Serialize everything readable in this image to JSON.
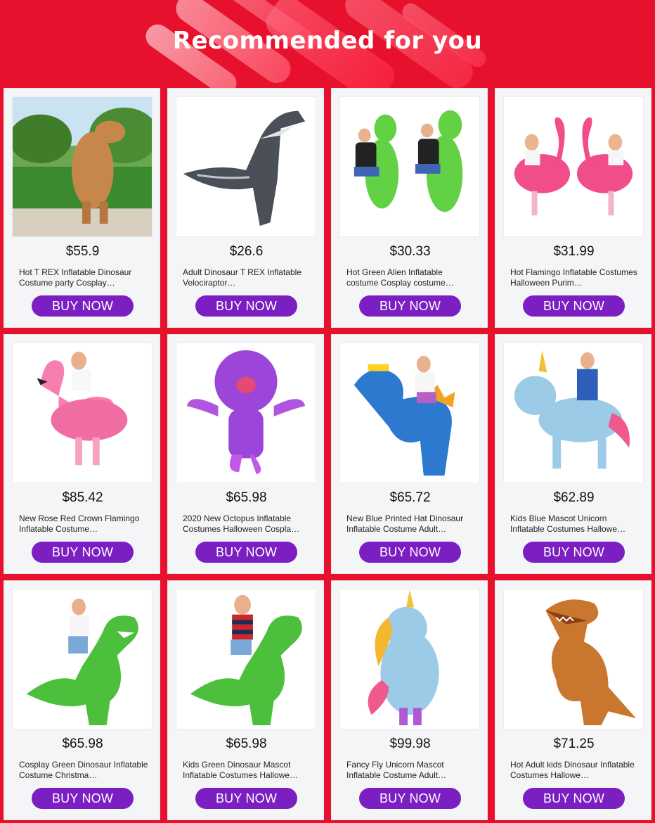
{
  "header": {
    "title": "Recommended for you"
  },
  "theme": {
    "background": "#e8112d",
    "button": "#7b1fc2",
    "card": "#f4f5f7"
  },
  "products": [
    {
      "price": "$55.9",
      "name": "Hot T REX Inflatable Dinosaur Costume party Cosplay…",
      "button": "BUY NOW",
      "image": "trex-costume-garden"
    },
    {
      "price": "$26.6",
      "name": "Adult Dinosaur T REX Inflatable Velociraptor…",
      "button": "BUY NOW",
      "image": "velociraptor-costume"
    },
    {
      "price": "$30.33",
      "name": "Hot Green Alien Inflatable costume Cosplay costume…",
      "button": "BUY NOW",
      "image": "green-alien-costume"
    },
    {
      "price": "$31.99",
      "name": "Hot Flamingo Inflatable Costumes Halloween Purim…",
      "button": "BUY NOW",
      "image": "flamingo-costume-pair"
    },
    {
      "price": "$85.42",
      "name": "New Rose Red Crown Flamingo Inflatable Costume…",
      "button": "BUY NOW",
      "image": "rose-flamingo-costume"
    },
    {
      "price": "$65.98",
      "name": "2020 New Octopus Inflatable Costumes Halloween Cospla…",
      "button": "BUY NOW",
      "image": "octopus-costume"
    },
    {
      "price": "$65.72",
      "name": "New Blue Printed Hat Dinosaur Inflatable Costume Adult…",
      "button": "BUY NOW",
      "image": "blue-dinosaur-costume"
    },
    {
      "price": "$62.89",
      "name": "Kids Blue Mascot Unicorn Inflatable Costumes Hallowe…",
      "button": "BUY NOW",
      "image": "blue-unicorn-costume"
    },
    {
      "price": "$65.98",
      "name": "Cosplay Green Dinosaur Inflatable Costume Christma…",
      "button": "BUY NOW",
      "image": "green-dinosaur-costume-adult"
    },
    {
      "price": "$65.98",
      "name": "Kids Green Dinosaur Mascot Inflatable Costumes Hallowe…",
      "button": "BUY NOW",
      "image": "green-dinosaur-costume-kid"
    },
    {
      "price": "$99.98",
      "name": "Fancy Fly Unicorn Mascot Inflatable Costume Adult…",
      "button": "BUY NOW",
      "image": "unicorn-mascot-costume"
    },
    {
      "price": "$71.25",
      "name": "Hot Adult kids Dinosaur Inflatable Costumes Hallowe…",
      "button": "BUY NOW",
      "image": "brown-trex-costume"
    }
  ]
}
